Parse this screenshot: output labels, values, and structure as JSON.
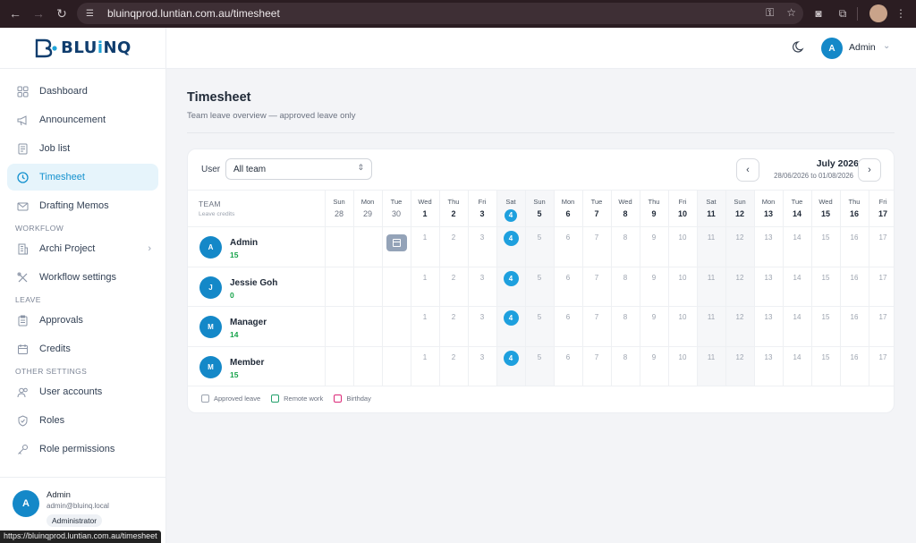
{
  "browser": {
    "url": "bluinqprod.luntian.com.au/timesheet",
    "status_url": "https://bluinqprod.luntian.com.au/timesheet"
  },
  "brand": {
    "name_pre": "BLU",
    "name_i": "i",
    "name_post": "NQ"
  },
  "sidebar": {
    "items": [
      {
        "label": "Dashboard",
        "icon": "grid-icon"
      },
      {
        "label": "Announcement",
        "icon": "megaphone-icon"
      },
      {
        "label": "Job list",
        "icon": "document-icon"
      },
      {
        "label": "Timesheet",
        "icon": "clock-icon",
        "active": true
      },
      {
        "label": "Drafting Memos",
        "icon": "envelope-icon"
      }
    ],
    "workflow_header": "WORKFLOW",
    "workflow_items": [
      {
        "label": "Archi Project",
        "icon": "building-icon"
      },
      {
        "label": "Workflow settings",
        "icon": "tools-icon"
      }
    ],
    "leave_header": "LEAVE",
    "leave_items": [
      {
        "label": "Approvals",
        "icon": "clipboard-icon"
      },
      {
        "label": "Credits",
        "icon": "calendar-icon"
      }
    ],
    "other_header": "OTHER SETTINGS",
    "other_items": [
      {
        "label": "User accounts",
        "icon": "users-icon"
      },
      {
        "label": "Roles",
        "icon": "shield-icon"
      },
      {
        "label": "Role permissions",
        "icon": "key-icon"
      }
    ],
    "user": {
      "initial": "A",
      "name": "Admin",
      "email": "admin@bluinq.local",
      "role": "Administrator"
    }
  },
  "header": {
    "user_initial": "A",
    "user_name": "Admin"
  },
  "page": {
    "title": "Timesheet",
    "subtitle": "Team leave overview — approved leave only"
  },
  "filter": {
    "user_label": "User",
    "team_value": "All team"
  },
  "calendar": {
    "month": "July 2026",
    "range": "28/06/2026 to 01/08/2026",
    "team_header": "TEAM",
    "credits_header": "Leave credits",
    "days": [
      {
        "dow": "Sun",
        "num": "28",
        "prev": true,
        "weekend": false
      },
      {
        "dow": "Mon",
        "num": "29",
        "prev": true,
        "weekend": false
      },
      {
        "dow": "Tue",
        "num": "30",
        "prev": true,
        "weekend": false
      },
      {
        "dow": "Wed",
        "num": "1"
      },
      {
        "dow": "Thu",
        "num": "2"
      },
      {
        "dow": "Fri",
        "num": "3"
      },
      {
        "dow": "Sat",
        "num": "4",
        "weekend": true,
        "today": true
      },
      {
        "dow": "Sun",
        "num": "5",
        "weekend": true
      },
      {
        "dow": "Mon",
        "num": "6"
      },
      {
        "dow": "Tue",
        "num": "7"
      },
      {
        "dow": "Wed",
        "num": "8"
      },
      {
        "dow": "Thu",
        "num": "9"
      },
      {
        "dow": "Fri",
        "num": "10"
      },
      {
        "dow": "Sat",
        "num": "11",
        "weekend": true
      },
      {
        "dow": "Sun",
        "num": "12",
        "weekend": true
      },
      {
        "dow": "Mon",
        "num": "13"
      },
      {
        "dow": "Tue",
        "num": "14"
      },
      {
        "dow": "Wed",
        "num": "15"
      },
      {
        "dow": "Thu",
        "num": "16"
      },
      {
        "dow": "Fri",
        "num": "17"
      }
    ],
    "members": [
      {
        "initial": "A",
        "name": "Admin",
        "credits": "15",
        "leave_day_index": 2
      },
      {
        "initial": "J",
        "name": "Jessie Goh",
        "credits": "0"
      },
      {
        "initial": "M",
        "name": "Manager",
        "credits": "14"
      },
      {
        "initial": "M",
        "name": "Member",
        "credits": "15"
      }
    ],
    "legend": [
      {
        "label": "Approved leave",
        "color": "#9ca3af"
      },
      {
        "label": "Remote work",
        "color": "#22a06b"
      },
      {
        "label": "Birthday",
        "color": "#db2777"
      }
    ]
  },
  "colors": {
    "accent": "#1ea0de",
    "active_bg": "#e6f4fb",
    "credits": "#16a34a"
  }
}
